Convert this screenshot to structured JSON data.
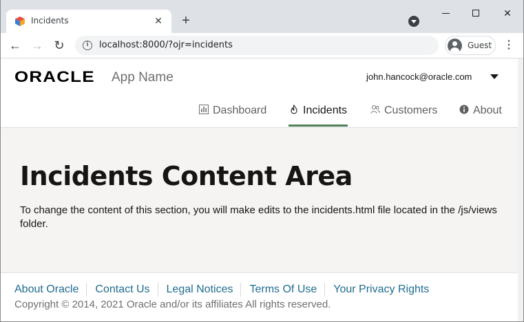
{
  "browser": {
    "tab_title": "Incidents",
    "tab_close": "✕",
    "new_tab": "+",
    "url": "localhost:8000/?ojr=incidents",
    "profile_name": "Guest",
    "menu": "⋮",
    "back": "←",
    "forward": "→",
    "reload": "↻",
    "close_window": "✕"
  },
  "header": {
    "logo_text": "ORACLE",
    "app_name": "App Name",
    "user_email": "john.hancock@oracle.com"
  },
  "nav": {
    "items": [
      {
        "label": "Dashboard",
        "icon": "chart-icon"
      },
      {
        "label": "Incidents",
        "icon": "fire-icon",
        "active": true
      },
      {
        "label": "Customers",
        "icon": "people-icon"
      },
      {
        "label": "About",
        "icon": "info-icon"
      }
    ]
  },
  "content": {
    "title": "Incidents Content Area",
    "body": "To change the content of this section, you will make edits to the incidents.html file located in the /js/views folder."
  },
  "footer": {
    "links": [
      "About Oracle",
      "Contact Us",
      "Legal Notices",
      "Terms Of Use",
      "Your Privacy Rights"
    ],
    "copyright": "Copyright © 2014, 2021 Oracle and/or its affiliates All rights reserved."
  },
  "colors": {
    "active_underline": "#4f7e5a",
    "footer_link": "#1e6b8f",
    "content_bg": "#f5f4f2"
  }
}
